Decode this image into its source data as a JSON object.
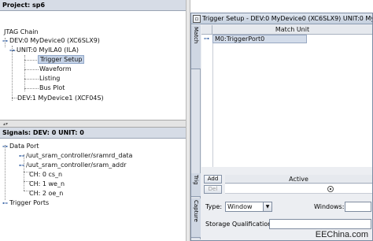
{
  "project_pane": {
    "header": "Project: sp6",
    "tree": {
      "jtag_chain": "JTAG Chain",
      "dev0": "DEV:0 MyDevice0 (XC6SLX9)",
      "unit0": "UNIT:0 MyILA0 (ILA)",
      "trigger_setup": "Trigger Setup",
      "waveform": "Waveform",
      "listing": "Listing",
      "bus_plot": "Bus Plot",
      "dev1": "DEV:1 MyDevice1 (XCF04S)"
    }
  },
  "signals_pane": {
    "header": "Signals: DEV: 0 UNIT: 0",
    "tree": {
      "data_port": "Data Port",
      "sramrd_data": "/uut_sram_controller/sramrd_data",
      "sram_addr": "/uut_sram_controller/sram_addr",
      "cs_n": "CH: 0 cs_n",
      "we_n": "CH: 1 we_n",
      "oe_n": "CH: 2 oe_n",
      "trigger_ports": "Trigger Ports"
    }
  },
  "trigger_window": {
    "title": "Trigger Setup - DEV:0 MyDevice0 (XC6SLX9) UNIT:0 MyILA0",
    "tabs": {
      "match": "Match",
      "trig": "Trig",
      "capture": "Capture"
    },
    "match": {
      "column_header": "Match Unit",
      "rows": [
        "M0:TriggerPort0"
      ]
    },
    "trig": {
      "add_label": "Add",
      "del_label": "Del",
      "active_header": "Active"
    },
    "capture": {
      "type_label": "Type:",
      "type_value": "Window",
      "windows_label": "Windows:",
      "storage_label": "Storage Qualification:"
    }
  },
  "watermark": "EEChina.com"
}
